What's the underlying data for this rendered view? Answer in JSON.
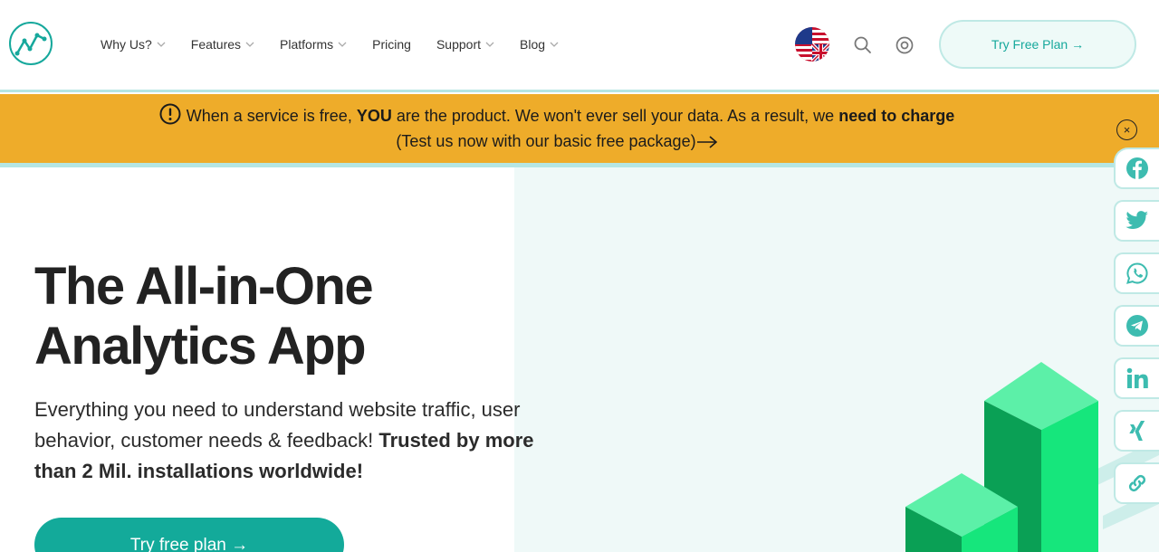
{
  "header": {
    "nav": [
      {
        "label": "Why Us?",
        "dropdown": true
      },
      {
        "label": "Features",
        "dropdown": true
      },
      {
        "label": "Platforms",
        "dropdown": true
      },
      {
        "label": "Pricing",
        "dropdown": false
      },
      {
        "label": "Support",
        "dropdown": true
      },
      {
        "label": "Blog",
        "dropdown": true
      }
    ],
    "try_button": "Try Free Plan →"
  },
  "banner": {
    "part1": "When a service is free, ",
    "bold1": "YOU",
    "part2": " are the product. We won't ever sell your data. As a result, we ",
    "bold2": "need to charge",
    "line2": "(Test us now with our basic free package)",
    "close": "×"
  },
  "hero": {
    "title_line1": "The All-in-One",
    "title_line2": "Analytics App",
    "desc_line1": "Everything you need to understand website traffic, user",
    "desc_line2_plain": "behavior, customer needs & feedback! ",
    "desc_line2_bold": "Trusted by more",
    "desc_line3_bold": "than 2 Mil. installations worldwide!",
    "cta": "Try free plan →"
  },
  "social": [
    "facebook-icon",
    "twitter-icon",
    "whatsapp-icon",
    "telegram-icon",
    "linkedin-icon",
    "xing-icon",
    "link-icon"
  ],
  "colors": {
    "accent": "#16a89c",
    "banner": "#eeac2a",
    "hero_bg": "#eff9f8",
    "green": "#13e07a"
  }
}
